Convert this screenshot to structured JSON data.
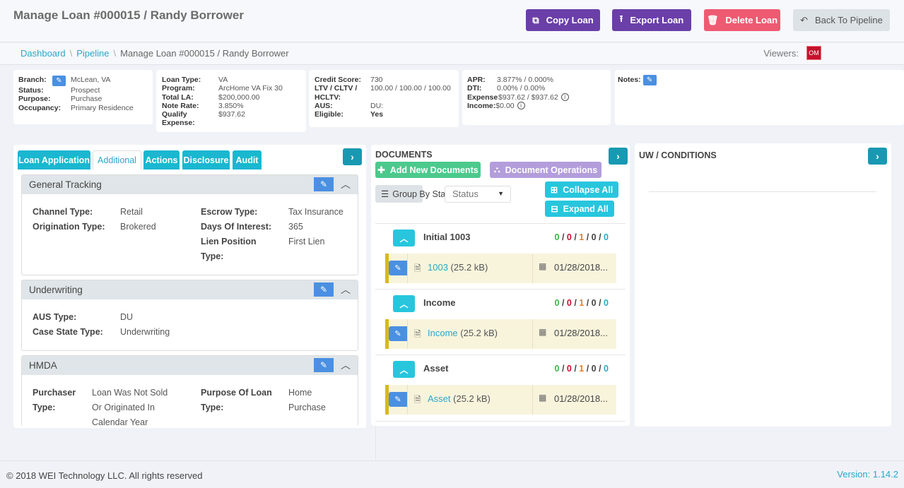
{
  "header": {
    "title": "Manage Loan #000015 / Randy Borrower",
    "buttons": {
      "copy": "Copy Loan",
      "export": "Export Loan",
      "delete": "Delete Loan",
      "back": "Back To Pipeline"
    }
  },
  "breadcrumb": {
    "items": [
      "Dashboard",
      "Pipeline",
      "Manage Loan #000015 / Randy Borrower"
    ],
    "separator": "\\",
    "viewers_label": "Viewers:",
    "viewer_initials": "OM"
  },
  "summary": {
    "card1": [
      {
        "k": "Branch:",
        "v": "McLean, VA"
      },
      {
        "k": "Status:",
        "v": "Prospect"
      },
      {
        "k": "Purpose:",
        "v": "Purchase"
      },
      {
        "k": "Occupancy:",
        "v": "Primary Residence"
      }
    ],
    "card2": [
      {
        "k": "Loan Type:",
        "v": "VA"
      },
      {
        "k": "Program:",
        "v": "ArcHome VA Fix 30"
      },
      {
        "k": "Total LA:",
        "v": "$200,000.00"
      },
      {
        "k": "Note Rate:",
        "v": "3.850%"
      },
      {
        "k": "Qualify Expense:",
        "v": "$937.62"
      }
    ],
    "card3": [
      {
        "k": "Credit Score:",
        "v": "730"
      },
      {
        "k": "LTV / CLTV / HCLTV:",
        "v": "100.00 / 100.00 / 100.00"
      },
      {
        "k": "AUS:",
        "v": "DU:"
      },
      {
        "k": "Eligible:",
        "v": "Yes"
      }
    ],
    "card4": [
      {
        "k": "APR:",
        "v": "3.877% / 0.000%"
      },
      {
        "k": "DTI:",
        "v": "0.00% / 0.00%"
      },
      {
        "k": "Expense:",
        "v": "$937.62 / $937.62"
      },
      {
        "k": "Income:",
        "v": "$0.00"
      }
    ],
    "notes_label": "Notes:"
  },
  "left_panel": {
    "tabs": [
      "Loan Application",
      "Additional",
      "Actions",
      "Disclosure",
      "Audit"
    ],
    "active_tab": "Additional",
    "sections": {
      "general": {
        "title": "General Tracking",
        "channel_k": "Channel Type:",
        "channel_v": "Retail",
        "orig_k": "Origination Type:",
        "orig_v": "Brokered",
        "escrow_k": "Escrow Type:",
        "escrow_v": "Tax Insurance",
        "days_k": "Days Of Interest:",
        "days_v": "365",
        "lien_k1": "Lien Position",
        "lien_k2": "Type:",
        "lien_v": "First Lien"
      },
      "underwriting": {
        "title": "Underwriting",
        "aus_k": "AUS Type:",
        "aus_v": "DU",
        "case_k": "Case State Type:",
        "case_v": "Underwriting"
      },
      "hmda": {
        "title": "HMDA",
        "purch_k1": "Purchaser",
        "purch_k2": "Type:",
        "purch_v1": "Loan Was Not Sold",
        "purch_v2": "Or Originated In",
        "purch_v3": "Calendar Year",
        "purpose_k1": "Purpose Of Loan",
        "purpose_k2": "Type:",
        "purpose_v1": "Home",
        "purpose_v2": "Purchase"
      }
    }
  },
  "documents": {
    "title": "DOCUMENTS",
    "add_label": "Add New Documents",
    "ops_label": "Document Operations",
    "group_by_label": "Group By Sta",
    "group_select_value": "Status",
    "collapse_all": "Collapse All",
    "expand_all": "Expand All",
    "groups": [
      {
        "title": "Initial 1003",
        "counts": [
          "0",
          "0",
          "1",
          "0",
          "0"
        ],
        "doc_name": "1003",
        "doc_size": "(25.2 kB)",
        "date": "01/28/2018..."
      },
      {
        "title": "Income",
        "counts": [
          "0",
          "0",
          "1",
          "0",
          "0"
        ],
        "doc_name": "Income",
        "doc_size": "(25.2 kB)",
        "date": "01/28/2018..."
      },
      {
        "title": "Asset",
        "counts": [
          "0",
          "0",
          "1",
          "0",
          "0"
        ],
        "doc_name": "Asset",
        "doc_size": "(25.2 kB)",
        "date": "01/28/2018..."
      }
    ],
    "count_colors": [
      "#3cb44b",
      "#c8102e",
      "#e67e22",
      "#444444",
      "#2aa7c9"
    ]
  },
  "conditions": {
    "title": "UW / CONDITIONS"
  },
  "footer": {
    "copyright": "© 2018 WEI Technology LLC. All rights reserved",
    "version": "Version: 1.14.2"
  }
}
